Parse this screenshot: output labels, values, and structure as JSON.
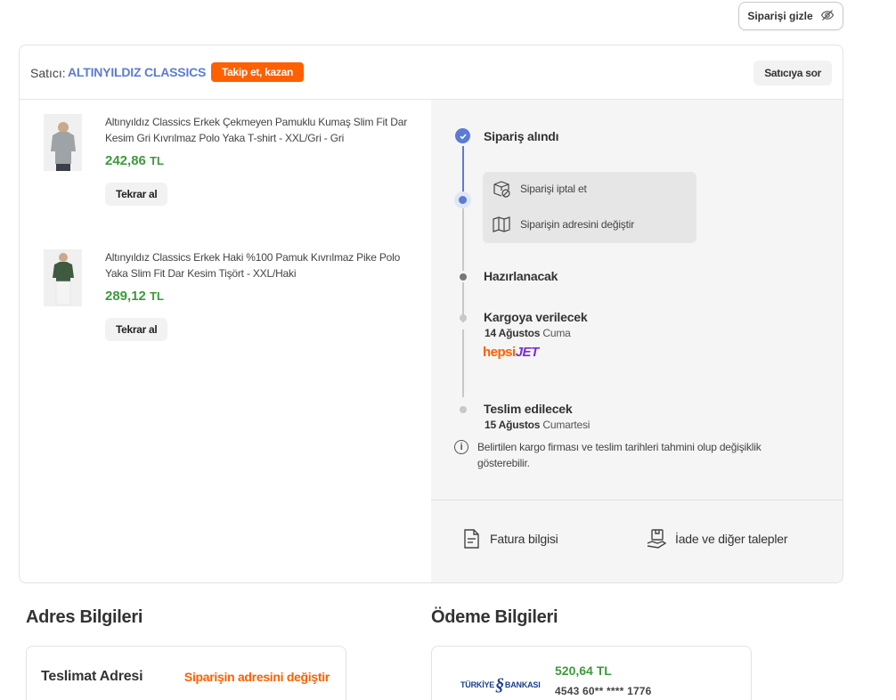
{
  "header": {
    "hide_order_label": "Siparişi gizle"
  },
  "seller": {
    "label": "Satıcı:",
    "name": "ALTINYILDIZ CLASSICS",
    "follow_badge": "Takip et, kazan",
    "ask_button": "Satıcıya sor"
  },
  "products": [
    {
      "title": "Altınyıldız Classics Erkek Çekmeyen Pamuklu Kumaş Slim Fit Dar Kesim Gri Kıvrılmaz Polo Yaka T-shirt - XXL/Gri - Gri",
      "price": "242,86",
      "currency": "TL",
      "rebuy_label": "Tekrar al",
      "shirt_color": "#9ea3a8"
    },
    {
      "title": "Altınyıldız Classics Erkek Haki %100 Pamuk Kıvrılmaz Pike Polo Yaka Slim Fit Dar Kesim Tişört - XXL/Haki",
      "price": "289,12",
      "currency": "TL",
      "rebuy_label": "Tekrar al",
      "shirt_color": "#3f5a3e"
    }
  ],
  "timeline": {
    "received": "Sipariş alındı",
    "actions": {
      "cancel": "Siparişi iptal et",
      "change_address": "Siparişin adresini değiştir"
    },
    "preparing": "Hazırlanacak",
    "shipping": {
      "title": "Kargoya verilecek",
      "date_bold": "14 Ağustos",
      "day": "Cuma",
      "carrier_part1": "hepsi",
      "carrier_part2": "JET"
    },
    "delivery": {
      "title": "Teslim edilecek",
      "date_bold": "15 Ağustos",
      "day": "Cumartesi"
    },
    "note": "Belirtilen kargo firması ve teslim tarihleri tahmini olup değişiklik gösterebilir."
  },
  "footer": {
    "invoice": "Fatura bilgisi",
    "returns": "İade ve diğer talepler"
  },
  "address": {
    "section_title": "Adres Bilgileri",
    "card_title": "Teslimat Adresi",
    "change_link": "Siparişin adresini değiştir"
  },
  "payment": {
    "section_title": "Ödeme Bilgileri",
    "bank_name_1": "TÜRKİYE",
    "bank_name_2": "BANKASI",
    "amount": "520,64 TL",
    "card_number": "4543 60** **** 1776"
  },
  "colors": {
    "accent": "#5b7bd5",
    "orange": "#ff6000",
    "price": "#3d9a3c"
  }
}
